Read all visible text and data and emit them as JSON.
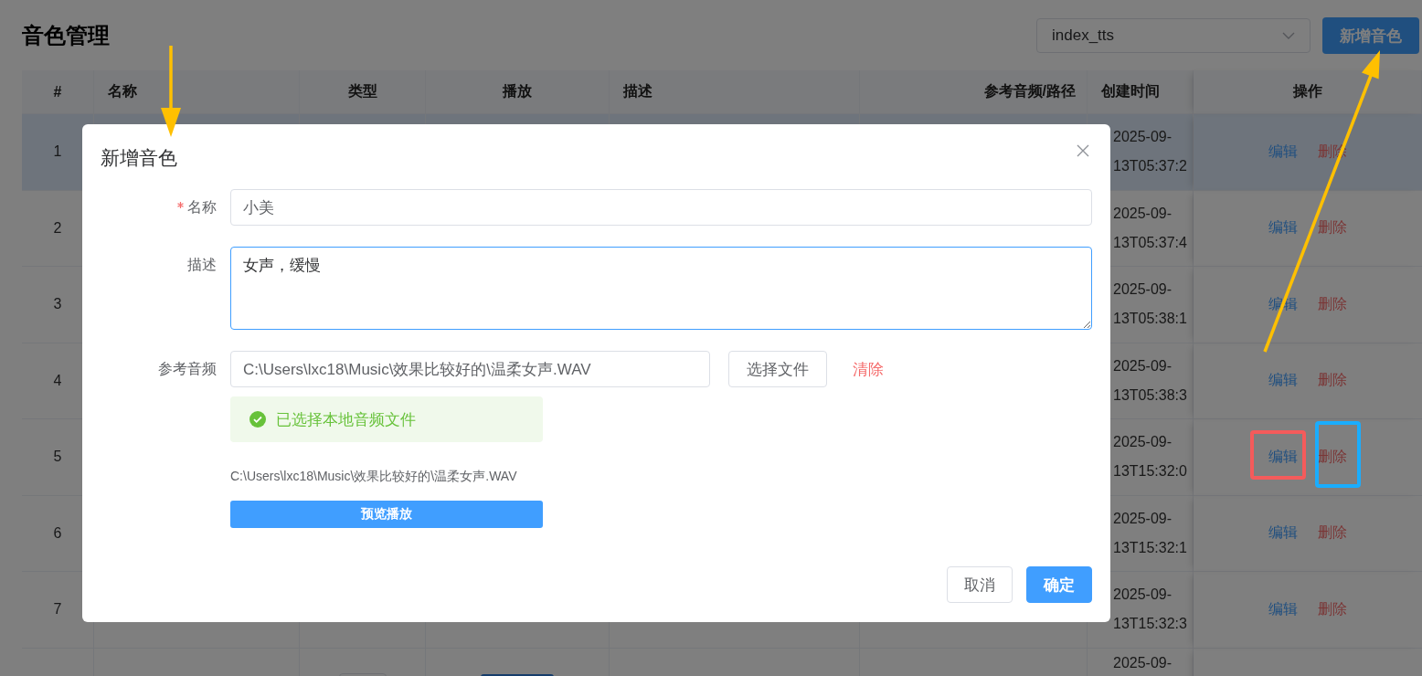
{
  "page": {
    "title": "音色管理",
    "engine_select": {
      "value": "index_tts"
    },
    "add_button": "新增音色"
  },
  "table": {
    "columns": [
      "#",
      "名称",
      "类型",
      "播放",
      "描述",
      "参考音频/路径",
      "创建时间",
      "操作"
    ],
    "rows": [
      {
        "index": "1",
        "created": "2025-09-\n13T05:37:2",
        "hovered": true,
        "actions": [
          "编辑",
          "删除"
        ]
      },
      {
        "index": "2",
        "created": "2025-09-\n13T05:37:4",
        "hovered": false,
        "actions": [
          "编辑",
          "删除"
        ]
      },
      {
        "index": "3",
        "created": "2025-09-\n13T05:38:1",
        "hovered": false,
        "actions": [
          "编辑",
          "删除"
        ]
      },
      {
        "index": "4",
        "created": "2025-09-\n13T05:38:3",
        "hovered": false,
        "actions": [
          "编辑",
          "删除"
        ]
      },
      {
        "index": "5",
        "created": "2025-09-\n13T15:32:0",
        "hovered": false,
        "actions": [
          "编辑",
          "删除"
        ]
      },
      {
        "index": "6",
        "created": "2025-09-\n13T15:32:1",
        "hovered": false,
        "actions": [
          "编辑",
          "删除"
        ]
      },
      {
        "index": "7",
        "created": "2025-09-\n13T15:32:3",
        "hovered": false,
        "actions": [
          "编辑",
          "删除"
        ]
      },
      {
        "created": "2025-09-",
        "hovered": false
      }
    ]
  },
  "dialog": {
    "title": "新增音色",
    "fields": [
      {
        "kind": "input",
        "label": "名称",
        "required": true,
        "value": "小美"
      },
      {
        "kind": "textarea",
        "label": "描述",
        "required": false,
        "value": "女声，缓慢",
        "focused": true
      },
      {
        "kind": "file",
        "label": "参考音频",
        "required": false,
        "value": "C:\\Users\\lxc18\\Music\\效果比较好的\\温柔女声.WAV",
        "choose_button": "选择文件",
        "clear_link": "清除",
        "alert": "已选择本地音频文件",
        "path": "C:\\Users\\lxc18\\Music\\效果比较好的\\温柔女声.WAV",
        "preview_button": "预览播放"
      }
    ],
    "buttons": [
      {
        "label": "取消",
        "kind": "default"
      },
      {
        "label": "确定",
        "kind": "primary"
      }
    ]
  },
  "annotations": [
    {
      "kind": "arrow",
      "color": "#ffc000"
    },
    {
      "kind": "arrow",
      "color": "#ffc000"
    },
    {
      "kind": "frame",
      "color": "#f45b5b"
    },
    {
      "kind": "frame",
      "color": "#1aadff"
    }
  ]
}
